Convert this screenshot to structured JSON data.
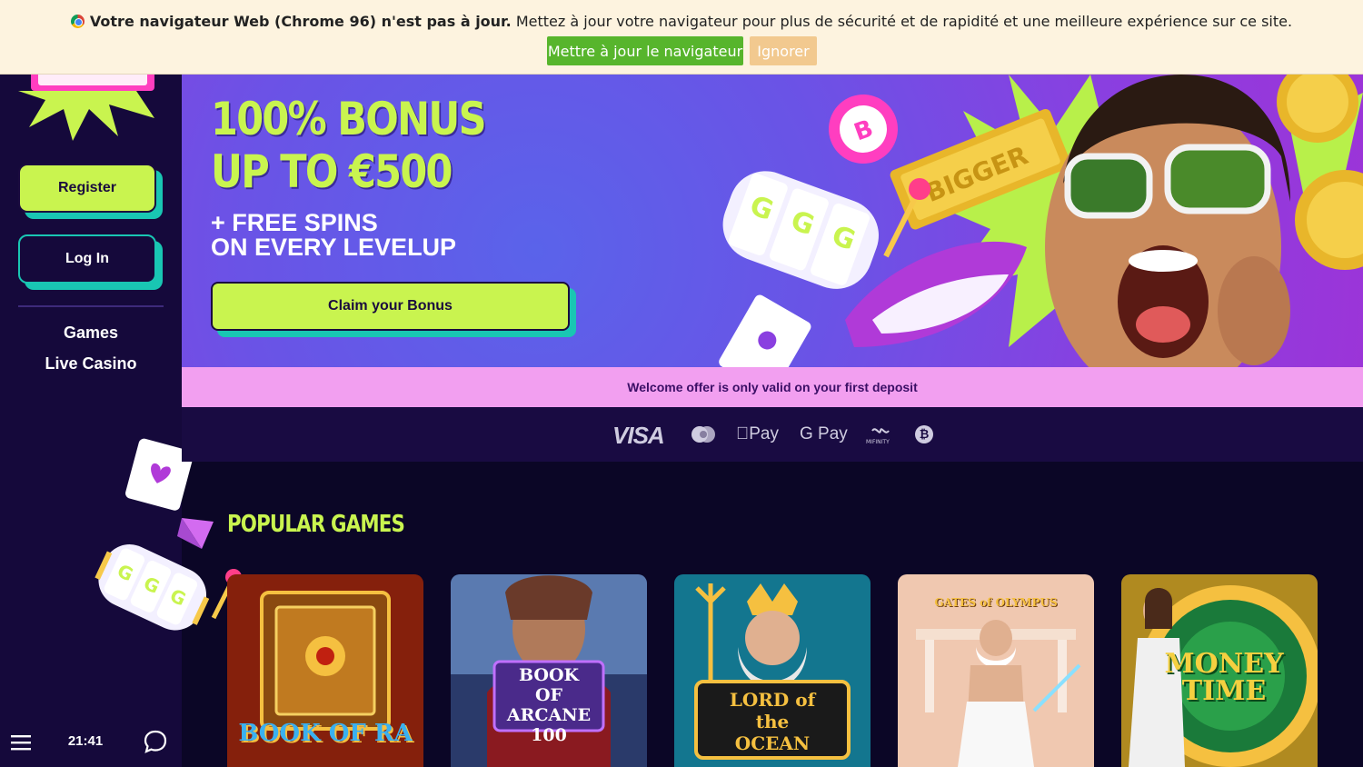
{
  "banner": {
    "bold_text": "Votre navigateur Web (Chrome 96) n'est pas à jour.",
    "text": " Mettez à jour votre navigateur pour plus de sécurité et de rapidité et une meilleure expérience sur ce site.",
    "update_label": "Mettre à jour le navigateur",
    "ignore_label": "Ignorer"
  },
  "sidebar": {
    "register_label": "Register",
    "login_label": "Log In",
    "nav": [
      {
        "label": "Games"
      },
      {
        "label": "Live Casino"
      }
    ],
    "clock": "21:41"
  },
  "hero": {
    "title_line1": "100% BONUS",
    "title_line2": "UP TO €500",
    "sub_line1": "+ FREE SPINS",
    "sub_line2": "ON EVERY LEVELUP",
    "claim_label": "Claim your Bonus"
  },
  "welcome_text": "Welcome offer is only valid on your first deposit",
  "payments": {
    "visa": "VISA",
    "apple_pay": "Pay",
    "google_pay": "G Pay",
    "mifinity": "MIFINITY"
  },
  "popular": {
    "title": "POPULAR GAMES",
    "games": [
      {
        "title": "BOOK OF RA"
      },
      {
        "title": "BOOK OF ARCANE 100"
      },
      {
        "title": "LORD of the OCEAN"
      },
      {
        "title": "GATES of OLYMPUS"
      },
      {
        "title": "MONEY TIME"
      }
    ]
  },
  "colors": {
    "lime": "#c9f44f",
    "teal": "#19c6b3",
    "sidebar": "#15093b",
    "page": "#0b0626",
    "pink_strip": "#f29ff0"
  }
}
